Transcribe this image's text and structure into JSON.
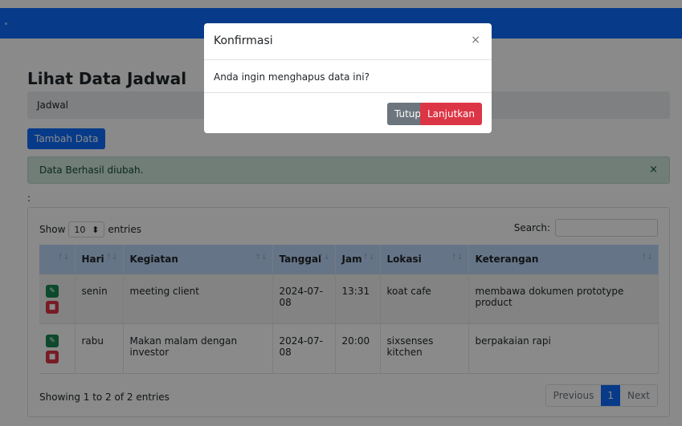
{
  "page": {
    "title": "Lihat Data Jadwal",
    "breadcrumb": "Jadwal",
    "add_button": "Tambah Data",
    "alert_text": "Data Berhasil diubah.",
    "alert_close": "×",
    "stray_text": ":"
  },
  "table_controls": {
    "show_label": "Show",
    "page_size": "10",
    "entries_label": "entries",
    "search_label": "Search:",
    "search_value": ""
  },
  "table": {
    "columns": [
      "",
      "Hari",
      "Kegiatan",
      "Tanggal",
      "Jam",
      "Lokasi",
      "Keterangan"
    ],
    "rows": [
      {
        "hari": "senin",
        "kegiatan": "meeting client",
        "tanggal": "2024-07-08",
        "jam": "13:31",
        "lokasi": "koat cafe",
        "keterangan": "membawa dokumen prototype product"
      },
      {
        "hari": "rabu",
        "kegiatan": "Makan malam dengan investor",
        "tanggal": "2024-07-08",
        "jam": "20:00",
        "lokasi": "sixsenses kitchen",
        "keterangan": "berpakaian rapi"
      }
    ],
    "sort_glyph": "↑↓",
    "edit_icon": "edit-icon",
    "delete_icon": "trash-icon"
  },
  "footer": {
    "info": "Showing 1 to 2 of 2 entries",
    "previous": "Previous",
    "current_page": "1",
    "next": "Next"
  },
  "modal": {
    "title": "Konfirmasi",
    "close": "×",
    "message": "Anda ingin menghapus data ini?",
    "cancel": "Tutup",
    "confirm": "Lanjutkan"
  },
  "colors": {
    "primary": "#0d6efd",
    "success": "#198754",
    "danger": "#dc3545",
    "secondary": "#6c757d",
    "alert_bg": "#d1e7dd"
  }
}
